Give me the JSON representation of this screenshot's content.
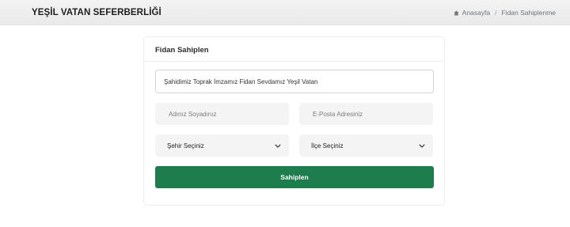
{
  "header": {
    "brand": "YEŞİL VATAN SEFERBERLİĞİ",
    "breadcrumb": {
      "home_icon": "home-icon",
      "home_label": "Anasayfa",
      "separator": "/",
      "current": "Fidan Sahiplenme"
    }
  },
  "form": {
    "title": "Fidan Sahiplen",
    "slogan_value": "Şahidimiz Toprak İmzamız Fidan Sevdamız Yeşil Vatan",
    "name_placeholder": "Adınız Soyadınız",
    "email_placeholder": "E-Posta Adresiniz",
    "city_select": "Şehir Seçiniz",
    "district_select": "İlçe Seçiniz",
    "submit_label": "Sahiplen"
  },
  "colors": {
    "primary_green": "#1e7d4c",
    "field_background": "#f4f4f4"
  }
}
